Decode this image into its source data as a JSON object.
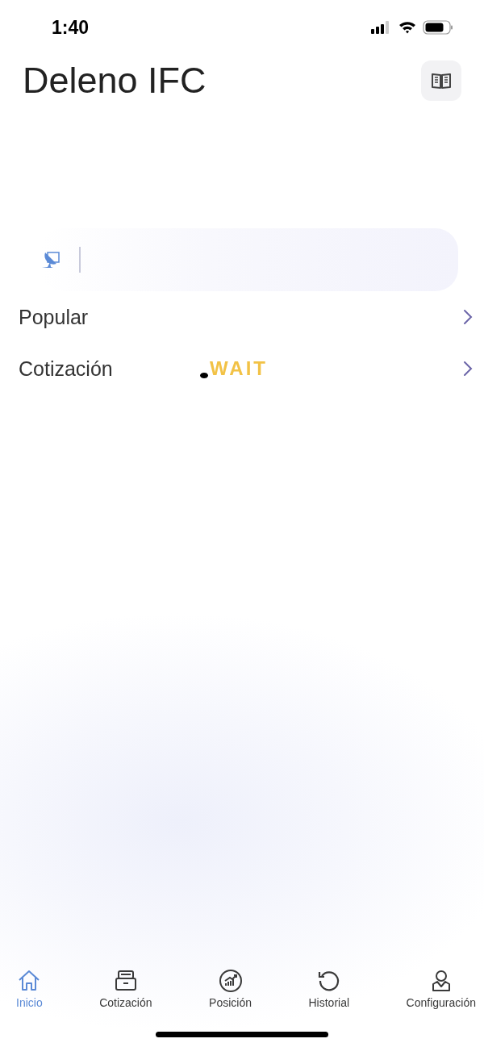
{
  "status_bar": {
    "time": "1:40"
  },
  "header": {
    "title": "Deleno IFC"
  },
  "rows": [
    {
      "label": "Popular"
    },
    {
      "label": "Cotización"
    }
  ],
  "loader": {
    "text": "WAIT"
  },
  "tabs": [
    {
      "label": "Inicio",
      "selected": true
    },
    {
      "label": "Cotización",
      "selected": false
    },
    {
      "label": "Posición",
      "selected": false
    },
    {
      "label": "Historial",
      "selected": false
    },
    {
      "label": "Configuración",
      "selected": false
    }
  ]
}
